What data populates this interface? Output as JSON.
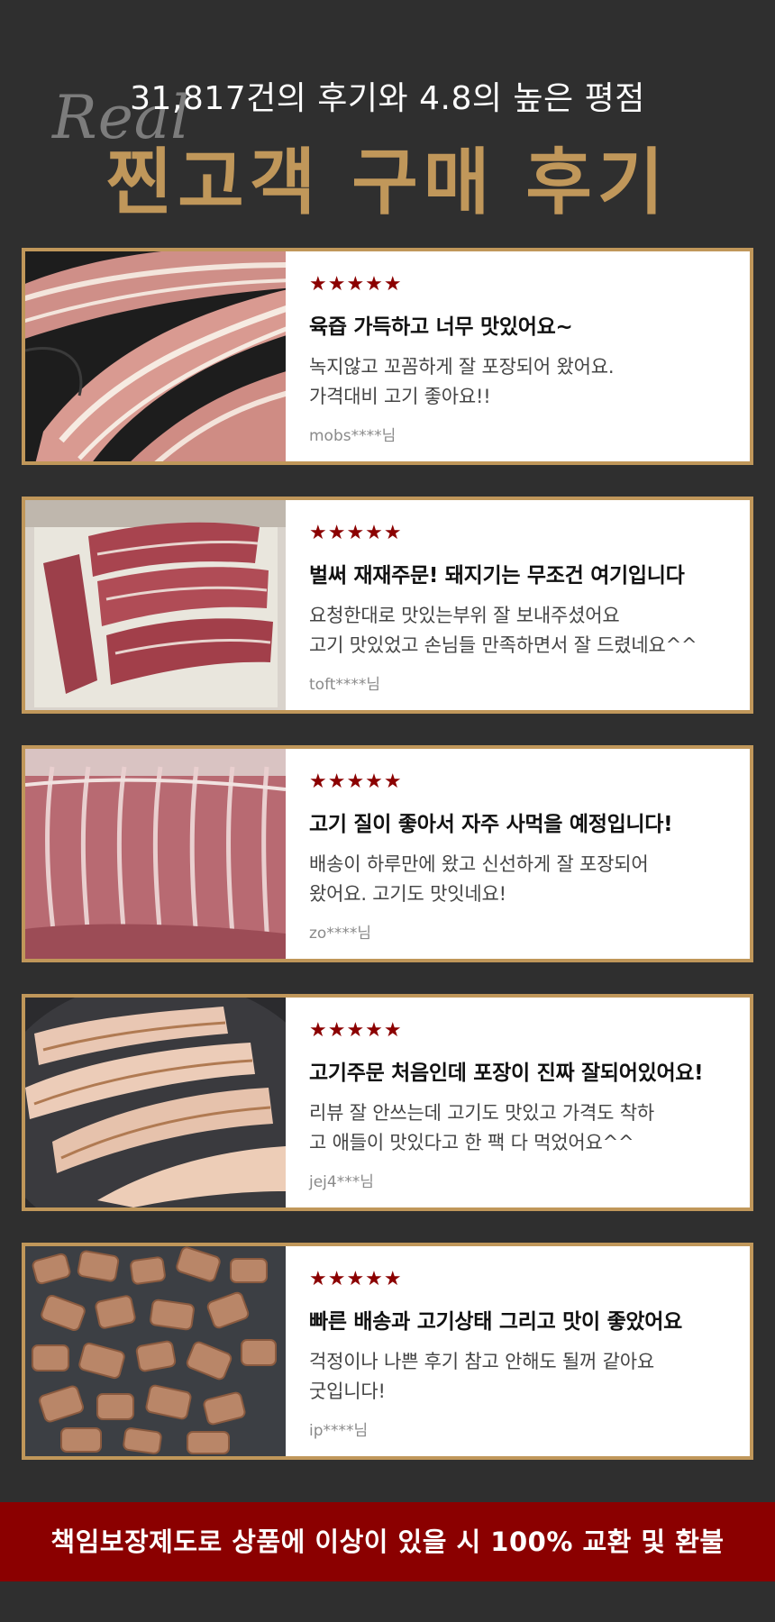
{
  "header": {
    "script_text": "Real",
    "subtitle": "31,817건의 후기와 4.8의 높은 평점",
    "title": "찐고객 구매 후기"
  },
  "reviews": [
    {
      "rating": 5,
      "stars": "★★★★★",
      "title": "육즙 가득하고 너무 맛있어요~",
      "body": "녹지않고 꼬꼼하게 잘 포장되어 왔어요.\n가격대비 고기 좋아요!!",
      "author": "mobs****님",
      "photo": "sliced-pork-belly-in-pan"
    },
    {
      "rating": 5,
      "stars": "★★★★★",
      "title": "벌써 재재주문! 돼지기는 무조건 여기입니다",
      "body": "요청한대로 맛있는부위 잘 보내주셨어요\n고기 맛있었고 손님들 만족하면서 잘 드렸네요^^",
      "author": "toft****님",
      "photo": "raw-pork-strips-on-tray"
    },
    {
      "rating": 5,
      "stars": "★★★★★",
      "title": "고기 질이 좋아서 자주 사먹을 예정입니다!",
      "body": "배송이 하루만에 왔고 신선하게 잘 포장되어\n왔어요. 고기도 맛잇네요!",
      "author": "zo****님",
      "photo": "packaged-pork-block"
    },
    {
      "rating": 5,
      "stars": "★★★★★",
      "title": "고기주문 처음인데 포장이 진짜 잘되어있어요!",
      "body": "리뷰 잘 안쓰는데 고기도 맛있고 가격도 착하\n고 애들이 맛있다고 한 팩 다 먹었어요^^",
      "author": "jej4***님",
      "photo": "grilled-pork-belly"
    },
    {
      "rating": 5,
      "stars": "★★★★★",
      "title": "빠른 배송과 고기상태 그리고 맛이 좋았어요",
      "body": "걱정이나 나쁜 후기 참고 안해도 될꺼 같아요\n굿입니다!",
      "author": "ip****님",
      "photo": "grilled-pork-cubes"
    }
  ],
  "footer": {
    "banner_text": "책임보장제도로 상품에 이상이 있을 시 100% 교환 및 환불"
  },
  "colors": {
    "background": "#2f2f2f",
    "gold": "#c0975a",
    "star_red": "#8b0000",
    "banner_red": "#8b0000"
  }
}
